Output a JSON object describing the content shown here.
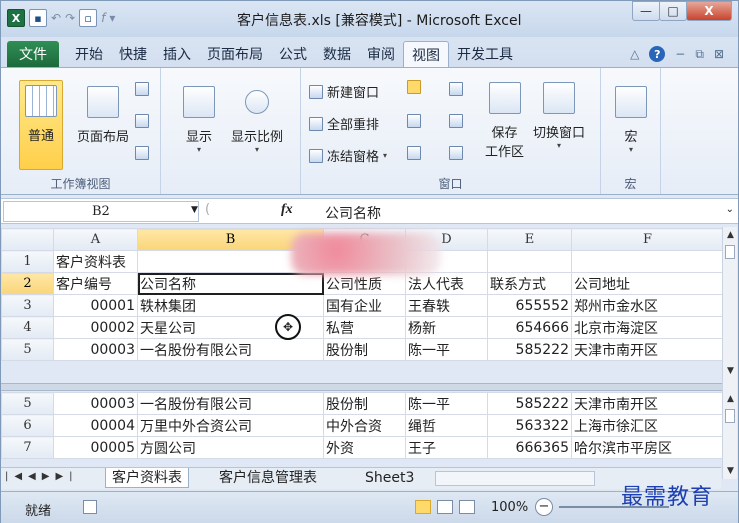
{
  "title": "客户信息表.xls [兼容模式] - Microsoft Excel",
  "window_buttons": {
    "minimize": "—",
    "maximize": "□",
    "close": "X"
  },
  "tabs": [
    "文件",
    "开始",
    "快捷",
    "插入",
    "页面布局",
    "公式",
    "数据",
    "审阅",
    "视图",
    "开发工具"
  ],
  "active_tab": "视图",
  "ribbon": {
    "group1": {
      "label": "工作簿视图",
      "normal": "普通",
      "page_layout": "页面布局"
    },
    "group2": {
      "show": "显示",
      "zoom": "显示比例"
    },
    "group3": {
      "label": "窗口",
      "new_window": "新建窗口",
      "arrange_all": "全部重排",
      "freeze": "冻结窗格",
      "save_ws": "保存",
      "workspace": "工作区",
      "switch": "切换窗口"
    },
    "group4": {
      "label": "宏",
      "macro": "宏"
    }
  },
  "formula_bar": {
    "namebox": "B2",
    "fx": "fx",
    "value": "公司名称"
  },
  "columns": [
    "",
    "A",
    "B",
    "C",
    "D",
    "E",
    "F"
  ],
  "top_rows": [
    {
      "n": "1",
      "cells": [
        "客户资料表",
        "",
        "",
        "",
        "",
        ""
      ]
    },
    {
      "n": "2",
      "cells": [
        "客户编号",
        "公司名称",
        "公司性质",
        "法人代表",
        "联系方式",
        "公司地址"
      ]
    },
    {
      "n": "3",
      "cells": [
        "00001",
        "轶林集团",
        "国有企业",
        "王春轶",
        "655552",
        "郑州市金水区"
      ]
    },
    {
      "n": "4",
      "cells": [
        "00002",
        "天星公司",
        "私营",
        "杨新",
        "654666",
        "北京市海淀区"
      ]
    },
    {
      "n": "5",
      "cells": [
        "00003",
        "一名股份有限公司",
        "股份制",
        "陈一平",
        "585222",
        "天津市南开区"
      ]
    }
  ],
  "bottom_rows": [
    {
      "n": "5",
      "cells": [
        "00003",
        "一名股份有限公司",
        "股份制",
        "陈一平",
        "585222",
        "天津市南开区"
      ]
    },
    {
      "n": "6",
      "cells": [
        "00004",
        "万里中外合资公司",
        "中外合资",
        "绳哲",
        "563322",
        "上海市徐汇区"
      ]
    },
    {
      "n": "7",
      "cells": [
        "00005",
        "方圆公司",
        "外资",
        "王子",
        "666365",
        "哈尔滨市平房区"
      ]
    }
  ],
  "sheets": [
    "客户资料表",
    "客户信息管理表",
    "Sheet3"
  ],
  "active_sheet": "客户资料表",
  "status": {
    "ready": "就绪",
    "zoom": "100%"
  },
  "watermark": "最需教育"
}
